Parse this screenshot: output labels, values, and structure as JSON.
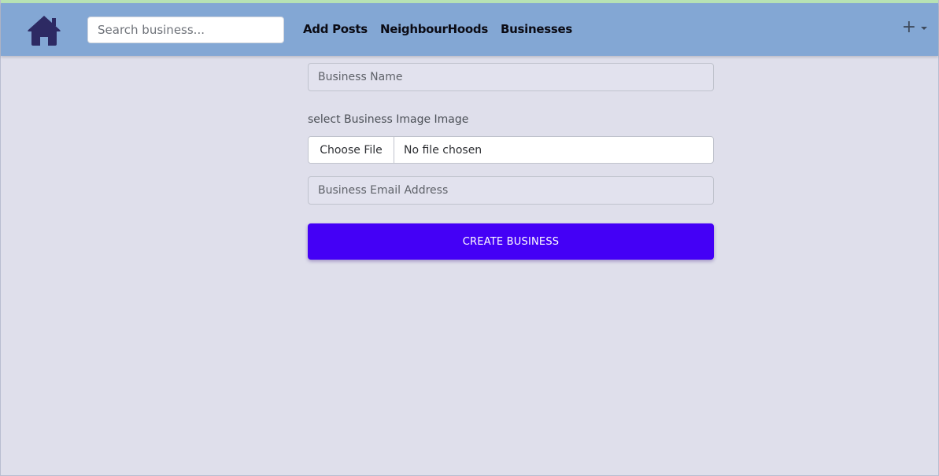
{
  "navbar": {
    "home_icon": "house-icon",
    "search_placeholder": "Search business...",
    "links": [
      "Add Posts",
      "NeighbourHoods",
      "Businesses"
    ],
    "plus_icon": "+",
    "colors": {
      "navbar": "#83a7d4",
      "top_strip": "#b7e2b4",
      "home_icon": "#2d2a63"
    }
  },
  "form": {
    "business_name_placeholder": "Business Name",
    "image_label": "select Business Image Image",
    "choose_file_label": "Choose File",
    "file_status": "No file chosen",
    "email_placeholder": "Business Email Address",
    "submit_label": "CREATE BUSINESS",
    "colors": {
      "submit": "#4400f6",
      "background": "#dfdfeb"
    }
  }
}
